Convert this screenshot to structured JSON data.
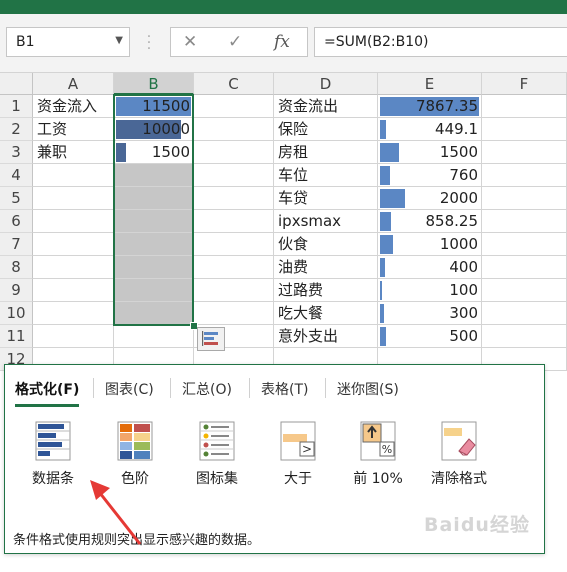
{
  "formula_bar": {
    "name_box": "B1",
    "formula": "=SUM(B2:B10)",
    "fx": "fx"
  },
  "columns": [
    "A",
    "B",
    "C",
    "D",
    "E",
    "F"
  ],
  "rows": [
    "1",
    "2",
    "3",
    "4",
    "5",
    "6",
    "7",
    "8",
    "9",
    "10",
    "11",
    "12"
  ],
  "col_a": [
    "资金流入",
    "工资",
    "兼职"
  ],
  "col_b": [
    "11500",
    "10000",
    "1500"
  ],
  "col_d": [
    "资金流出",
    "保险",
    "房租",
    "车位",
    "车贷",
    "ipxsmax",
    "伙食",
    "油费",
    "过路费",
    "吃大餐",
    "意外支出"
  ],
  "col_e": [
    "7867.35",
    "449.1",
    "1500",
    "760",
    "2000",
    "858.25",
    "1000",
    "400",
    "100",
    "300",
    "500"
  ],
  "bar_fraction_b": [
    1.0,
    0.87,
    0.13
  ],
  "bar_fraction_e": [
    1.0,
    0.06,
    0.19,
    0.1,
    0.25,
    0.11,
    0.13,
    0.05,
    0.015,
    0.04,
    0.06
  ],
  "colors": {
    "accent": "#217346",
    "bar_primary": "#5b87c4",
    "bar_dark": "#4a6796"
  },
  "quick_analysis": {
    "tabs": [
      "格式化(F)",
      "图表(C)",
      "汇总(O)",
      "表格(T)",
      "迷你图(S)"
    ],
    "active_tab": 0,
    "items": [
      {
        "label": "数据条",
        "icon": "data-bars-icon"
      },
      {
        "label": "色阶",
        "icon": "color-scale-icon"
      },
      {
        "label": "图标集",
        "icon": "icon-set-icon"
      },
      {
        "label": "大于",
        "icon": "greater-than-icon"
      },
      {
        "label": "前 10%",
        "icon": "top-10-percent-icon"
      },
      {
        "label": "清除格式",
        "icon": "clear-format-icon"
      }
    ],
    "description": "条件格式使用规则突出显示感兴趣的数据。"
  },
  "watermark": "Baidu经验"
}
